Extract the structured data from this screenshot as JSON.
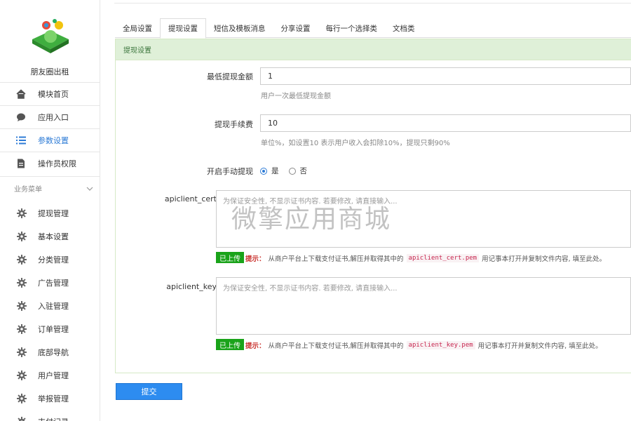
{
  "app": {
    "name": "朋友圈出租"
  },
  "sidebar": {
    "main_items": [
      {
        "label": "模块首页",
        "icon": "home-icon"
      },
      {
        "label": "应用入口",
        "icon": "chat-icon"
      },
      {
        "label": "参数设置",
        "icon": "list-icon",
        "active": true
      },
      {
        "label": "操作员权限",
        "icon": "document-icon"
      }
    ],
    "group_title": "业务菜单",
    "sub_items": [
      {
        "label": "提现管理",
        "icon": "gear-icon"
      },
      {
        "label": "基本设置",
        "icon": "gear-icon"
      },
      {
        "label": "分类管理",
        "icon": "gear-icon"
      },
      {
        "label": "广告管理",
        "icon": "gear-icon"
      },
      {
        "label": "入驻管理",
        "icon": "gear-icon"
      },
      {
        "label": "订单管理",
        "icon": "gear-icon"
      },
      {
        "label": "底部导航",
        "icon": "gear-icon"
      },
      {
        "label": "用户管理",
        "icon": "gear-icon"
      },
      {
        "label": "举报管理",
        "icon": "gear-icon"
      },
      {
        "label": "支付记录",
        "icon": "gear-icon"
      }
    ]
  },
  "tabs": [
    {
      "label": "全局设置"
    },
    {
      "label": "提现设置",
      "active": true
    },
    {
      "label": "短信及模板消息"
    },
    {
      "label": "分享设置"
    },
    {
      "label": "每行一个选择类"
    },
    {
      "label": "文档类"
    }
  ],
  "panel": {
    "title": "提现设置",
    "min_withdraw": {
      "label": "最低提现金额",
      "value": "1",
      "help": "用户一次最低提现金额"
    },
    "fee": {
      "label": "提现手续费",
      "value": "10",
      "help": "单位%，如设置10 表示用户收入会扣除10%，提现只剩90%"
    },
    "manual": {
      "label": "开启手动提现",
      "yes": "是",
      "no": "否",
      "selected": "是"
    },
    "cert": {
      "label": "apiclient_cert",
      "placeholder": "为保证安全性, 不显示证书内容. 若要修改, 请直接输入...",
      "badge": "已上传",
      "tip": "提示：",
      "text_before": "从商户平台上下载支付证书,解压并取得其中的",
      "file": "apiclient_cert.pem",
      "text_after": "用记事本打开并复制文件内容, 填至此处。"
    },
    "key": {
      "label": "apiclient_key",
      "placeholder": "为保证安全性, 不显示证书内容. 若要修改, 请直接输入...",
      "badge": "已上传",
      "tip": "提示：",
      "text_before": "从商户平台上下载支付证书,解压并取得其中的",
      "file": "apiclient_key.pem",
      "text_after": "用记事本打开并复制文件内容, 填至此处。"
    }
  },
  "watermark": "微擎应用商城",
  "submit_label": "提交",
  "colors": {
    "accent": "#2d7bd6",
    "panel_head": "#dff0d8",
    "badge_green": "#1aa31a",
    "submit": "#2d8cf0"
  }
}
